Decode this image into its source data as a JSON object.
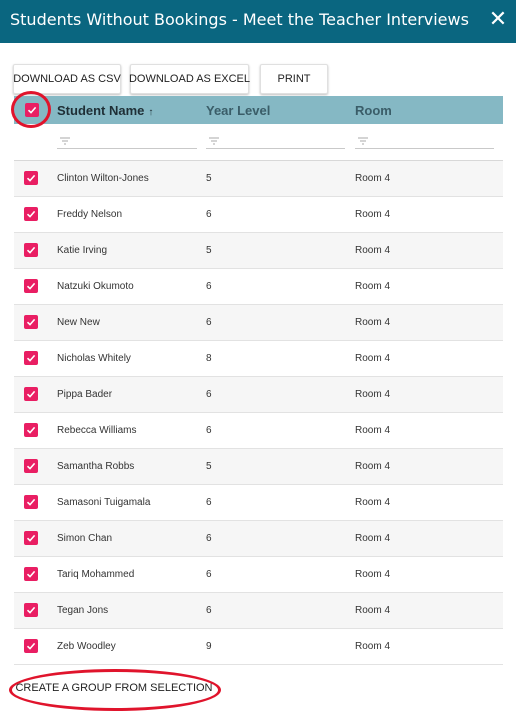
{
  "dialog": {
    "title": "Students Without Bookings - Meet the Teacher Interviews",
    "close_glyph": "✕"
  },
  "toolbar": {
    "csv_label": "DOWNLOAD AS CSV",
    "excel_label": "DOWNLOAD AS EXCEL",
    "print_label": "PRINT"
  },
  "grid": {
    "columns": {
      "name": "Student Name",
      "year": "Year Level",
      "room": "Room"
    },
    "sort_glyph": "↑",
    "rows": [
      {
        "name": "Clinton Wilton-Jones",
        "year": "5",
        "room": "Room 4"
      },
      {
        "name": "Freddy Nelson",
        "year": "6",
        "room": "Room 4"
      },
      {
        "name": "Katie Irving",
        "year": "5",
        "room": "Room 4"
      },
      {
        "name": "Natzuki Okumoto",
        "year": "6",
        "room": "Room 4"
      },
      {
        "name": "New New",
        "year": "6",
        "room": "Room 4"
      },
      {
        "name": "Nicholas Whitely",
        "year": "8",
        "room": "Room 4"
      },
      {
        "name": "Pippa Bader",
        "year": "6",
        "room": "Room 4"
      },
      {
        "name": "Rebecca Williams",
        "year": "6",
        "room": "Room 4"
      },
      {
        "name": "Samantha Robbs",
        "year": "5",
        "room": "Room 4"
      },
      {
        "name": "Samasoni Tuigamala",
        "year": "6",
        "room": "Room 4"
      },
      {
        "name": "Simon Chan",
        "year": "6",
        "room": "Room 4"
      },
      {
        "name": "Tariq Mohammed",
        "year": "6",
        "room": "Room 4"
      },
      {
        "name": "Tegan Jons",
        "year": "6",
        "room": "Room 4"
      },
      {
        "name": "Zeb Woodley",
        "year": "9",
        "room": "Room 4"
      }
    ]
  },
  "actions": {
    "create_group_label": "CREATE A GROUP FROM SELECTION"
  },
  "colors": {
    "titlebar": "#0a6680",
    "header": "#85b8c4",
    "checkbox": "#e91e63",
    "highlight": "#e0142c"
  },
  "icons": {
    "close": "close-icon",
    "sort": "sort-ascending-icon",
    "filter": "filter-icon",
    "check": "checkmark-icon"
  }
}
